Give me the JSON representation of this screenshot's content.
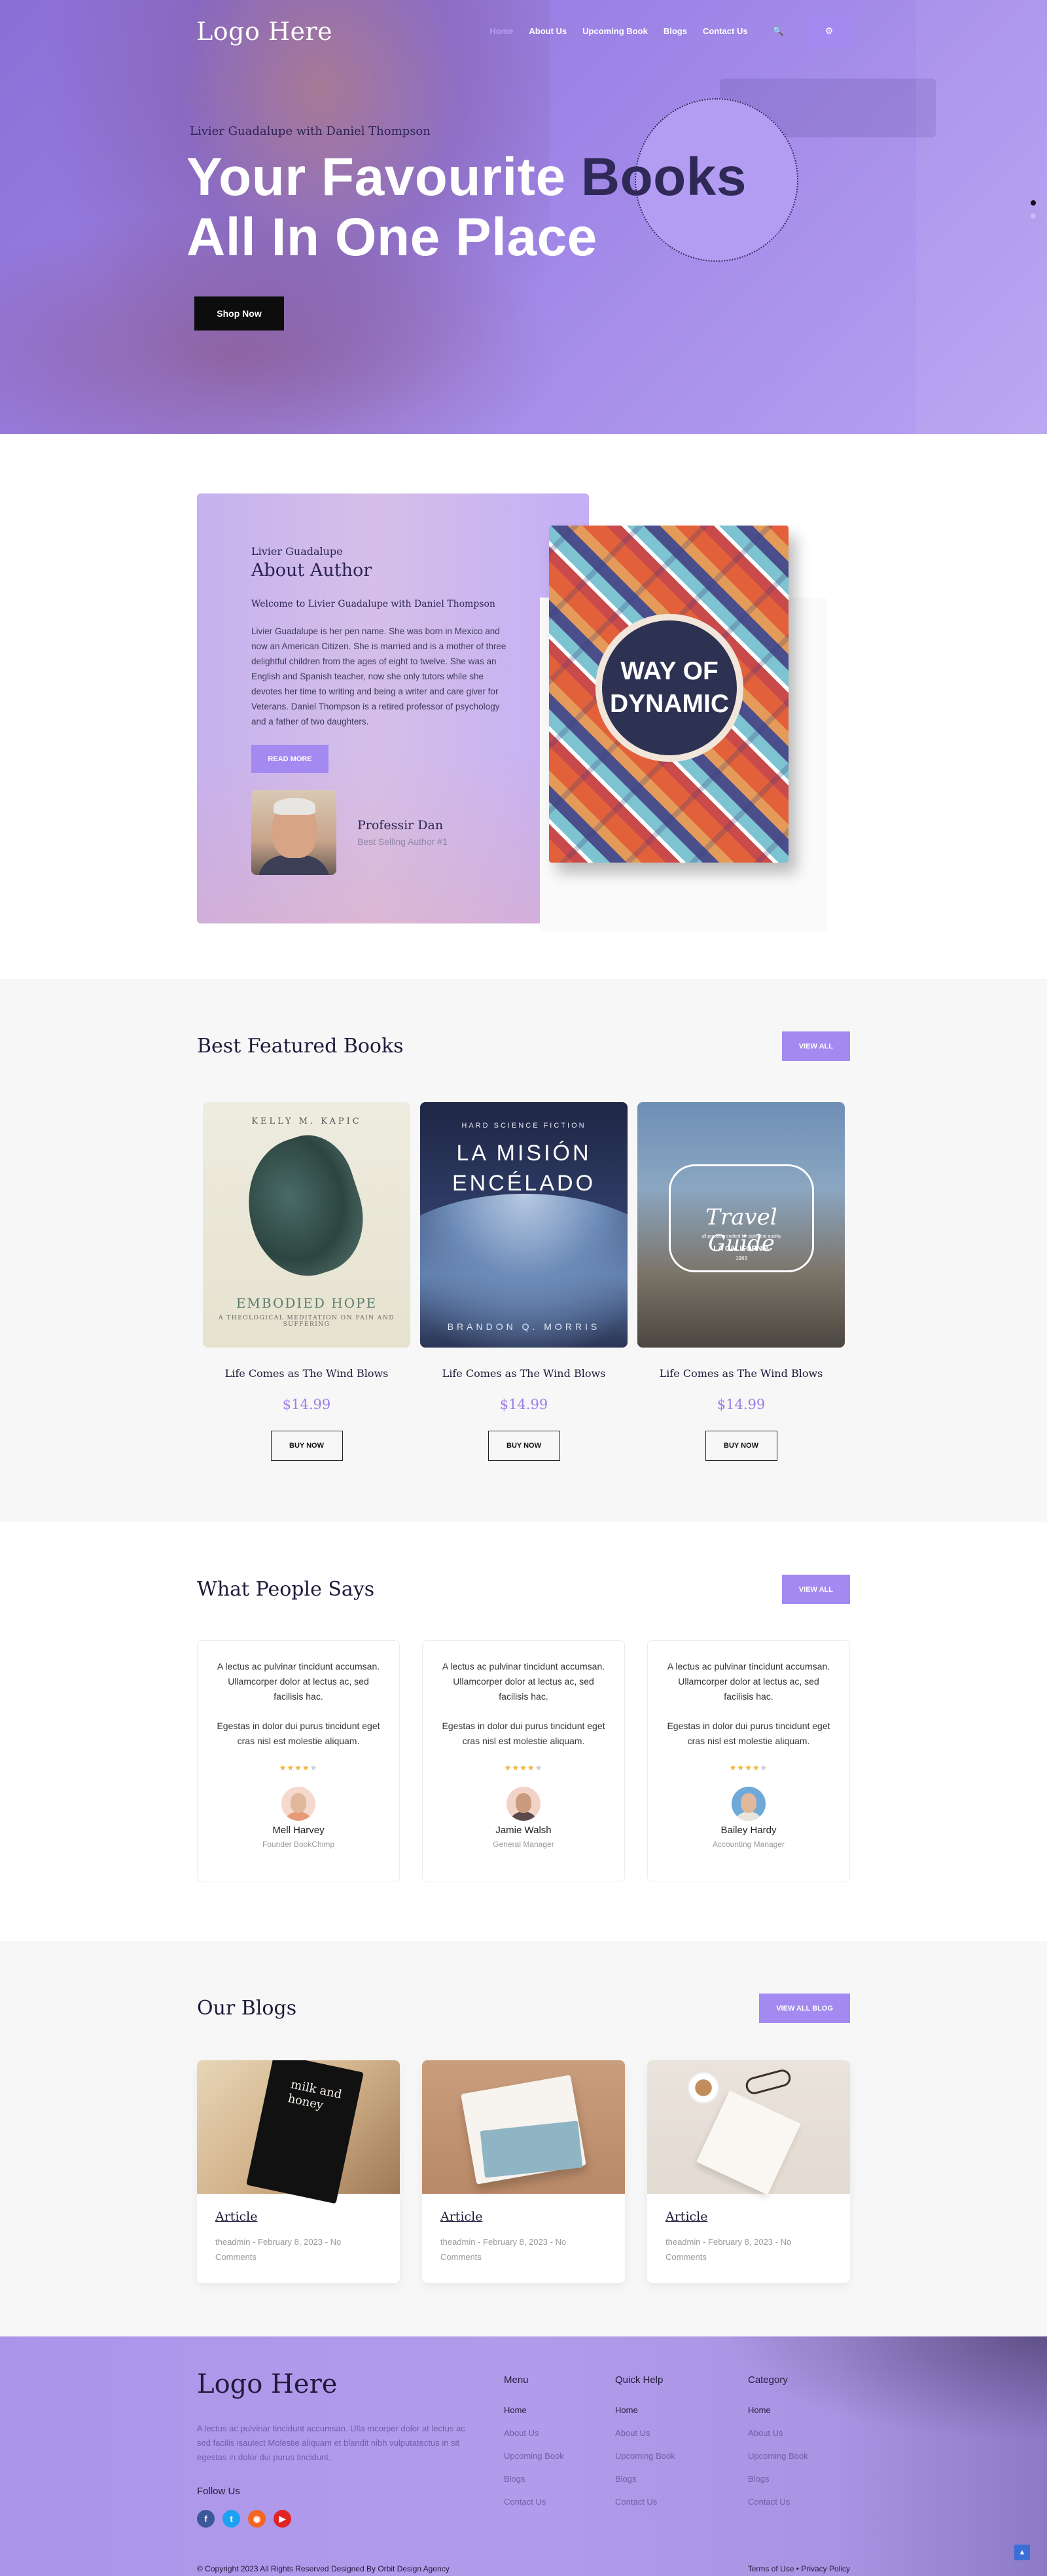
{
  "nav": {
    "logo": "Logo Here",
    "links": [
      {
        "label": "Home"
      },
      {
        "label": "About Us"
      },
      {
        "label": "Upcoming Book"
      },
      {
        "label": "Blogs"
      },
      {
        "label": "Contact Us"
      }
    ],
    "search_icon": "search-icon",
    "settings_icon": "gear-icon"
  },
  "hero": {
    "kicker": "Livier Guadalupe with Daniel Thompson",
    "title_line1_a": "Your Favourite",
    "title_line1_b": "Books",
    "title_line2": "All In One Place",
    "cta": "Shop Now"
  },
  "about": {
    "kicker": "Livier Guadalupe",
    "heading": "About Author",
    "welcome": "Welcome to Livier Guadalupe with Daniel Thompson",
    "bio": "Livier Guadalupe is her pen name. She was born in Mexico and now an American Citizen. She is married and is a mother of three delightful children from the ages of eight to twelve. She was an English and Spanish teacher, now she only tutors while she devotes her time to writing and being a writer and care giver for Veterans. Daniel Thompson is a retired professor of psychology and a father of two daughters.",
    "read_more": "READ MORE",
    "author_name": "Professir Dan",
    "author_role": "Best Selling Author #1",
    "book_cover_title": [
      "WAY OF",
      "DYNAMIC"
    ]
  },
  "featured": {
    "heading": "Best Featured Books",
    "view_all": "VIEW ALL",
    "books": [
      {
        "title": "Life Comes as The Wind Blows",
        "price": "$14.99",
        "buy": "BUY NOW",
        "cover_top": "KELLY M. KAPIC",
        "cover_main": "EMBODIED HOPE",
        "cover_sub": "A THEOLOGICAL MEDITATION ON PAIN AND SUFFERING"
      },
      {
        "title": "Life Comes as The Wind Blows",
        "price": "$14.99",
        "buy": "BUY NOW",
        "cover_top": "HARD SCIENCE FICTION",
        "cover_main_1": "LA MISIÓN",
        "cover_main_2": "ENCÉLADO",
        "cover_author": "BRANDON Q. MORRIS"
      },
      {
        "title": "Life Comes as The Wind Blows",
        "price": "$14.99",
        "buy": "BUY NOW",
        "cover_main": "Travel Guide",
        "cover_sub": "all products crafted for style and quality",
        "cover_loc": "LA CALIFORNIA",
        "cover_year": "1963"
      }
    ]
  },
  "testimonials": {
    "heading": "What People Says",
    "view_all": "VIEW ALL",
    "items": [
      {
        "p1": "A lectus ac pulvinar tincidunt accumsan. Ullamcorper dolor at lectus ac, sed facilisis hac.",
        "p2": "Egestas in dolor dui purus tincidunt eget cras nisl est molestie aliquam.",
        "rating": 4,
        "name": "Mell Harvey",
        "role": "Founder BookChimp",
        "avatar_color": "#e79a77"
      },
      {
        "p1": "A lectus ac pulvinar tincidunt accumsan. Ullamcorper dolor at lectus ac, sed facilisis hac.",
        "p2": "Egestas in dolor dui purus tincidunt eget cras nisl est molestie aliquam.",
        "rating": 4,
        "name": "Jamie Walsh",
        "role": "General Manager",
        "avatar_color": "#f2d3c7"
      },
      {
        "p1": "A lectus ac pulvinar tincidunt accumsan. Ullamcorper dolor at lectus ac, sed facilisis hac.",
        "p2": "Egestas in dolor dui purus tincidunt eget cras nisl est molestie aliquam.",
        "rating": 4,
        "name": "Bailey Hardy",
        "role": "Accounting Manager",
        "avatar_color": "#6fa9d8"
      }
    ]
  },
  "blogs": {
    "heading": "Our Blogs",
    "view_all": "VIEW ALL BLOG",
    "items": [
      {
        "title": "Article",
        "meta": "theadmin - February 8, 2023 - No Comments",
        "image_text": "milk and honey"
      },
      {
        "title": "Article",
        "meta": "theadmin - February 8, 2023 - No Comments"
      },
      {
        "title": "Article",
        "meta": "theadmin - February 8, 2023 - No Comments"
      }
    ]
  },
  "footer": {
    "logo": "Logo Here",
    "desc": "A lectus ac pulvinar tincidunt accumsan. Ulla mcorper dolor at lectus ac sed facilis isaulect Molestie aliquam et blandit nibh vulputatectus in sit egestas in dolor dui purus tincidunt.",
    "follow": "Follow Us",
    "socials": [
      {
        "icon": "facebook-icon",
        "glyph": "f",
        "color": "#3b5998"
      },
      {
        "icon": "twitter-icon",
        "glyph": "t",
        "color": "#1da1f2"
      },
      {
        "icon": "rss-icon",
        "glyph": "◉",
        "color": "#f26522"
      },
      {
        "icon": "youtube-icon",
        "glyph": "▶",
        "color": "#e02424"
      }
    ],
    "columns": [
      {
        "title": "Menu",
        "links": [
          "Home",
          "About Us",
          "Upcoming Book",
          "Blogs",
          "Contact Us"
        ]
      },
      {
        "title": "Quick Help",
        "links": [
          "Home",
          "About Us",
          "Upcoming Book",
          "Blogs",
          "Contact Us"
        ]
      },
      {
        "title": "Category",
        "links": [
          "Home",
          "About Us",
          "Upcoming Book",
          "Blogs",
          "Contact Us"
        ]
      }
    ],
    "copyright": "© Copyright 2023 All Rights Reserved Designed By Orbit Design Agency",
    "terms": "Terms of Use",
    "separator": "•",
    "privacy": "Privacy Policy"
  },
  "colors": {
    "accent": "#a48af0",
    "dark": "#1f1a3a",
    "price": "#9b7de8"
  }
}
